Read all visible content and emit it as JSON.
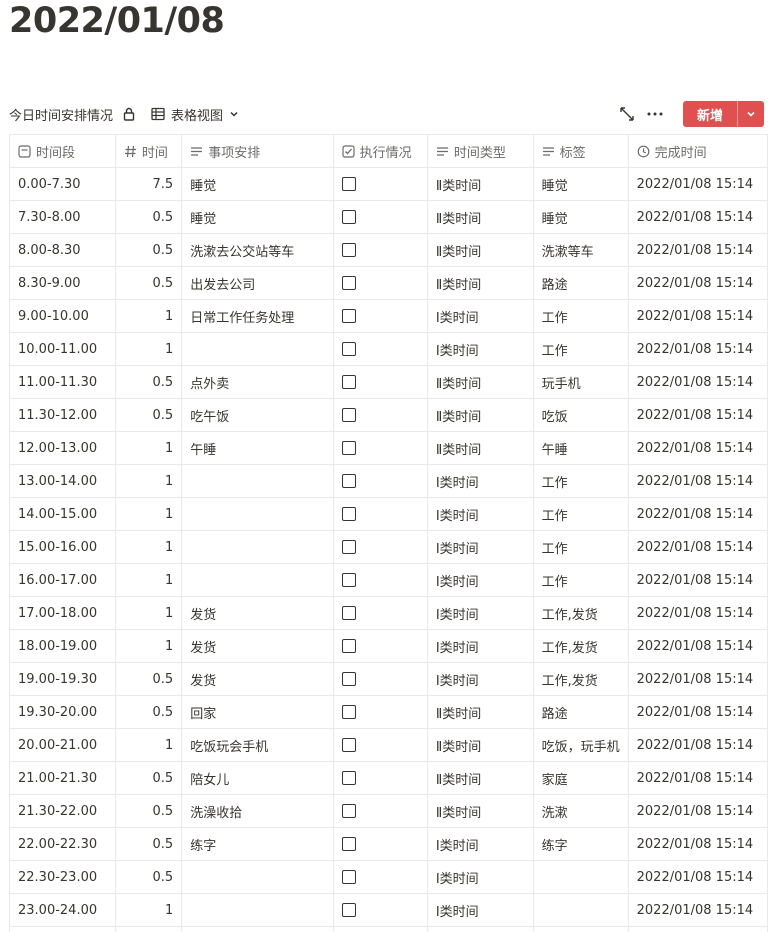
{
  "page": {
    "title": "2022/01/08"
  },
  "toolbar": {
    "db_name": "今日时间安排情况",
    "view_name": "表格视图",
    "new_label": "新增"
  },
  "icons": {
    "lock": "lock-icon",
    "view": "table-icon",
    "expand": "expand-icon",
    "more": "more-icon"
  },
  "colors": {
    "accent": "#e15050",
    "border": "#e9e9e7",
    "text": "#37352f"
  },
  "columns": [
    {
      "label": "时间段",
      "icon": "title-icon"
    },
    {
      "label": "时间",
      "icon": "number-icon"
    },
    {
      "label": "事项安排",
      "icon": "text-icon"
    },
    {
      "label": "执行情况",
      "icon": "checkbox-icon"
    },
    {
      "label": "时间类型",
      "icon": "text-icon"
    },
    {
      "label": "标签",
      "icon": "text-icon"
    },
    {
      "label": "完成时间",
      "icon": "clock-icon"
    }
  ],
  "rows": [
    {
      "period": "0.00-7.30",
      "hours": "7.5",
      "task": "睡觉",
      "done": false,
      "type": "Ⅱ类时间",
      "tag": "睡觉",
      "finished": "2022/01/08 15:14"
    },
    {
      "period": "7.30-8.00",
      "hours": "0.5",
      "task": "睡觉",
      "done": false,
      "type": "Ⅱ类时间",
      "tag": "睡觉",
      "finished": "2022/01/08 15:14"
    },
    {
      "period": "8.00-8.30",
      "hours": "0.5",
      "task": "洗漱去公交站等车",
      "done": false,
      "type": "Ⅱ类时间",
      "tag": "洗漱等车",
      "finished": "2022/01/08 15:14"
    },
    {
      "period": "8.30-9.00",
      "hours": "0.5",
      "task": "出发去公司",
      "done": false,
      "type": "Ⅱ类时间",
      "tag": "路途",
      "finished": "2022/01/08 15:14"
    },
    {
      "period": "9.00-10.00",
      "hours": "1",
      "task": "日常工作任务处理",
      "done": false,
      "type": "Ⅰ类时间",
      "tag": "工作",
      "finished": "2022/01/08 15:14"
    },
    {
      "period": "10.00-11.00",
      "hours": "1",
      "task": "",
      "done": false,
      "type": "Ⅰ类时间",
      "tag": "工作",
      "finished": "2022/01/08 15:14"
    },
    {
      "period": "11.00-11.30",
      "hours": "0.5",
      "task": "点外卖",
      "done": false,
      "type": "Ⅱ类时间",
      "tag": "玩手机",
      "finished": "2022/01/08 15:14"
    },
    {
      "period": "11.30-12.00",
      "hours": "0.5",
      "task": "吃午饭",
      "done": false,
      "type": "Ⅱ类时间",
      "tag": "吃饭",
      "finished": "2022/01/08 15:14"
    },
    {
      "period": "12.00-13.00",
      "hours": "1",
      "task": "午睡",
      "done": false,
      "type": "Ⅱ类时间",
      "tag": "午睡",
      "finished": "2022/01/08 15:14"
    },
    {
      "period": "13.00-14.00",
      "hours": "1",
      "task": "",
      "done": false,
      "type": "Ⅰ类时间",
      "tag": "工作",
      "finished": "2022/01/08 15:14"
    },
    {
      "period": "14.00-15.00",
      "hours": "1",
      "task": "",
      "done": false,
      "type": "Ⅰ类时间",
      "tag": "工作",
      "finished": "2022/01/08 15:14"
    },
    {
      "period": "15.00-16.00",
      "hours": "1",
      "task": "",
      "done": false,
      "type": "Ⅰ类时间",
      "tag": "工作",
      "finished": "2022/01/08 15:14"
    },
    {
      "period": "16.00-17.00",
      "hours": "1",
      "task": "",
      "done": false,
      "type": "Ⅰ类时间",
      "tag": "工作",
      "finished": "2022/01/08 15:14"
    },
    {
      "period": "17.00-18.00",
      "hours": "1",
      "task": "发货",
      "done": false,
      "type": "Ⅰ类时间",
      "tag": "工作,发货",
      "finished": "2022/01/08 15:14"
    },
    {
      "period": "18.00-19.00",
      "hours": "1",
      "task": "发货",
      "done": false,
      "type": "Ⅰ类时间",
      "tag": "工作,发货",
      "finished": "2022/01/08 15:14"
    },
    {
      "period": "19.00-19.30",
      "hours": "0.5",
      "task": "发货",
      "done": false,
      "type": "Ⅰ类时间",
      "tag": "工作,发货",
      "finished": "2022/01/08 15:14"
    },
    {
      "period": "19.30-20.00",
      "hours": "0.5",
      "task": "回家",
      "done": false,
      "type": "Ⅱ类时间",
      "tag": "路途",
      "finished": "2022/01/08 15:14"
    },
    {
      "period": "20.00-21.00",
      "hours": "1",
      "task": "吃饭玩会手机",
      "done": false,
      "type": "Ⅱ类时间",
      "tag": "吃饭，玩手机",
      "finished": "2022/01/08 15:14"
    },
    {
      "period": "21.00-21.30",
      "hours": "0.5",
      "task": "陪女儿",
      "done": false,
      "type": "Ⅱ类时间",
      "tag": "家庭",
      "finished": "2022/01/08 15:14"
    },
    {
      "period": "21.30-22.00",
      "hours": "0.5",
      "task": "洗澡收拾",
      "done": false,
      "type": "Ⅱ类时间",
      "tag": "洗漱",
      "finished": "2022/01/08 15:14"
    },
    {
      "period": "22.00-22.30",
      "hours": "0.5",
      "task": "练字",
      "done": false,
      "type": "Ⅰ类时间",
      "tag": "练字",
      "finished": "2022/01/08 15:14"
    },
    {
      "period": "22.30-23.00",
      "hours": "0.5",
      "task": "",
      "done": false,
      "type": "Ⅰ类时间",
      "tag": "",
      "finished": "2022/01/08 15:14"
    },
    {
      "period": "23.00-24.00",
      "hours": "1",
      "task": "",
      "done": false,
      "type": "Ⅰ类时间",
      "tag": "",
      "finished": "2022/01/08 15:14"
    }
  ]
}
